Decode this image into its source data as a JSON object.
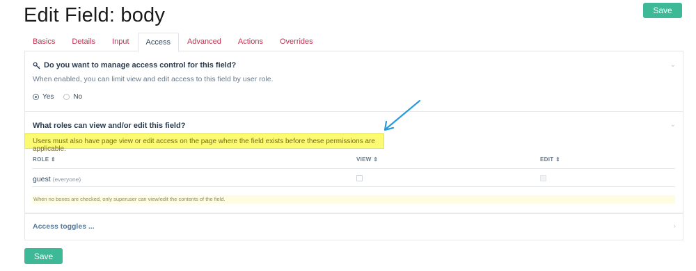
{
  "page": {
    "title": "Edit Field: body",
    "save_label": "Save"
  },
  "tabs": [
    {
      "label": "Basics",
      "active": false
    },
    {
      "label": "Details",
      "active": false
    },
    {
      "label": "Input",
      "active": false
    },
    {
      "label": "Access",
      "active": true
    },
    {
      "label": "Advanced",
      "active": false
    },
    {
      "label": "Actions",
      "active": false
    },
    {
      "label": "Overrides",
      "active": false
    }
  ],
  "access_control": {
    "icon": "key-icon",
    "question": "Do you want to manage access control for this field?",
    "description": "When enabled, you can limit view and edit access to this field by user role.",
    "options": [
      "Yes",
      "No"
    ],
    "selected": "Yes"
  },
  "roles": {
    "question": "What roles can view and/or edit this field?",
    "note": "Users must also have page view or edit access on the page where the field exists before these permissions are applicable.",
    "columns": [
      "ROLE",
      "VIEW",
      "EDIT"
    ],
    "sort_icon": "⇕",
    "rows": [
      {
        "role": "guest",
        "qualifier": "(everyone)",
        "view": false,
        "edit": false,
        "edit_disabled": true
      }
    ],
    "footer_note": "When no boxes are checked, only superuser can view/edit the contents of the field."
  },
  "toggles": {
    "label": "Access toggles ..."
  },
  "colors": {
    "accent": "#3eb998",
    "tab_link": "#c0304f",
    "highlight": "#fbfb73",
    "arrow": "#2a9ad9"
  }
}
